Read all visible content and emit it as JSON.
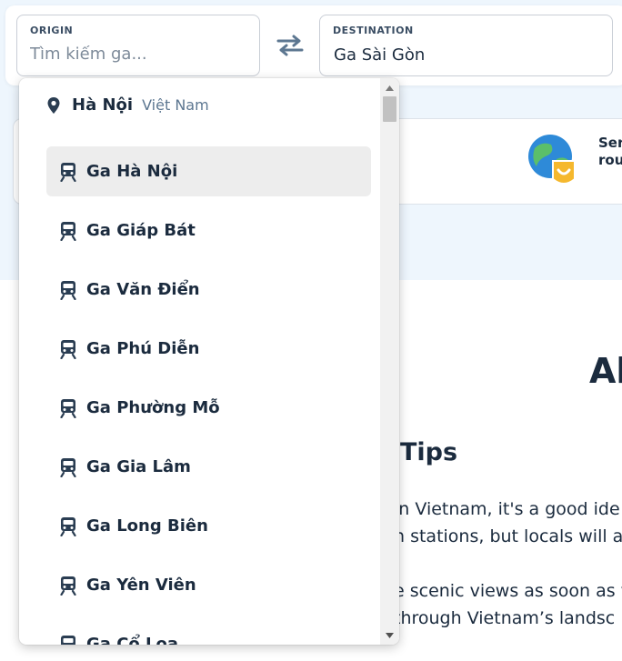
{
  "search": {
    "origin": {
      "label": "ORIGIN",
      "placeholder": "Tìm kiếm ga..."
    },
    "destination": {
      "label": "DESTINATION",
      "value": "Ga Sài Gòn"
    }
  },
  "promo": {
    "line1": "Ser",
    "line2": "rou"
  },
  "content": {
    "about_heading": "Ab",
    "tips_heading": "Tips",
    "paragraph1": [
      "in Vietnam, it's a good ide",
      "n stations, but locals will a"
    ],
    "paragraph2": [
      "e scenic views as soon as y",
      "through Vietnam’s landsc"
    ]
  },
  "dropdown": {
    "city": "Hà Nội",
    "country": "Việt Nam",
    "stations": [
      {
        "label": "Ga Hà Nội",
        "active": true
      },
      {
        "label": "Ga Giáp Bát"
      },
      {
        "label": "Ga Văn Điển"
      },
      {
        "label": "Ga Phú Diễn"
      },
      {
        "label": "Ga Phường Mỗ"
      },
      {
        "label": "Ga Gia Lâm"
      },
      {
        "label": "Ga Long Biên"
      },
      {
        "label": "Ga Yên Viên"
      },
      {
        "label": "Ga Cổ Loa"
      }
    ],
    "icons": {
      "city": "map-pin-icon",
      "station": "train-icon"
    }
  },
  "colors": {
    "text": "#1b2b3e",
    "hero_bg": "#eef6fd",
    "active_item": "#ededed",
    "muted": "#5d7791"
  }
}
